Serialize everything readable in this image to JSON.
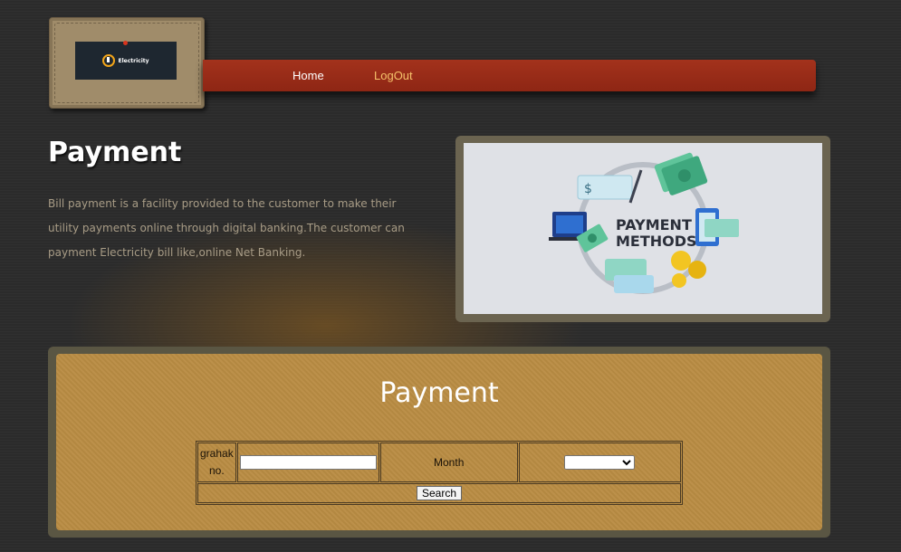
{
  "logo": {
    "text": "Electricity",
    "colors": {
      "background": "#a08c6a",
      "badge": "#1e2730",
      "accent": "#f2a51a"
    }
  },
  "nav": {
    "items": [
      {
        "label": "Home",
        "color": "#ffffff"
      },
      {
        "label": "LogOut",
        "color": "#f5c16a"
      }
    ],
    "bar_color": "#9a2d18"
  },
  "header": {
    "title": "Payment",
    "description": "Bill payment is a facility provided to the customer to make their utility payments online through digital banking.The customer can payment Electricity bill like,online Net Banking."
  },
  "illustration": {
    "title_line1": "PAYMENT",
    "title_line2": "METHODS",
    "currency_symbol": "$"
  },
  "payment_form": {
    "title": "Payment",
    "grahak_label": "grahak no.",
    "grahak_value": "",
    "month_label": "Month",
    "month_selected": "",
    "search_label": "Search"
  }
}
